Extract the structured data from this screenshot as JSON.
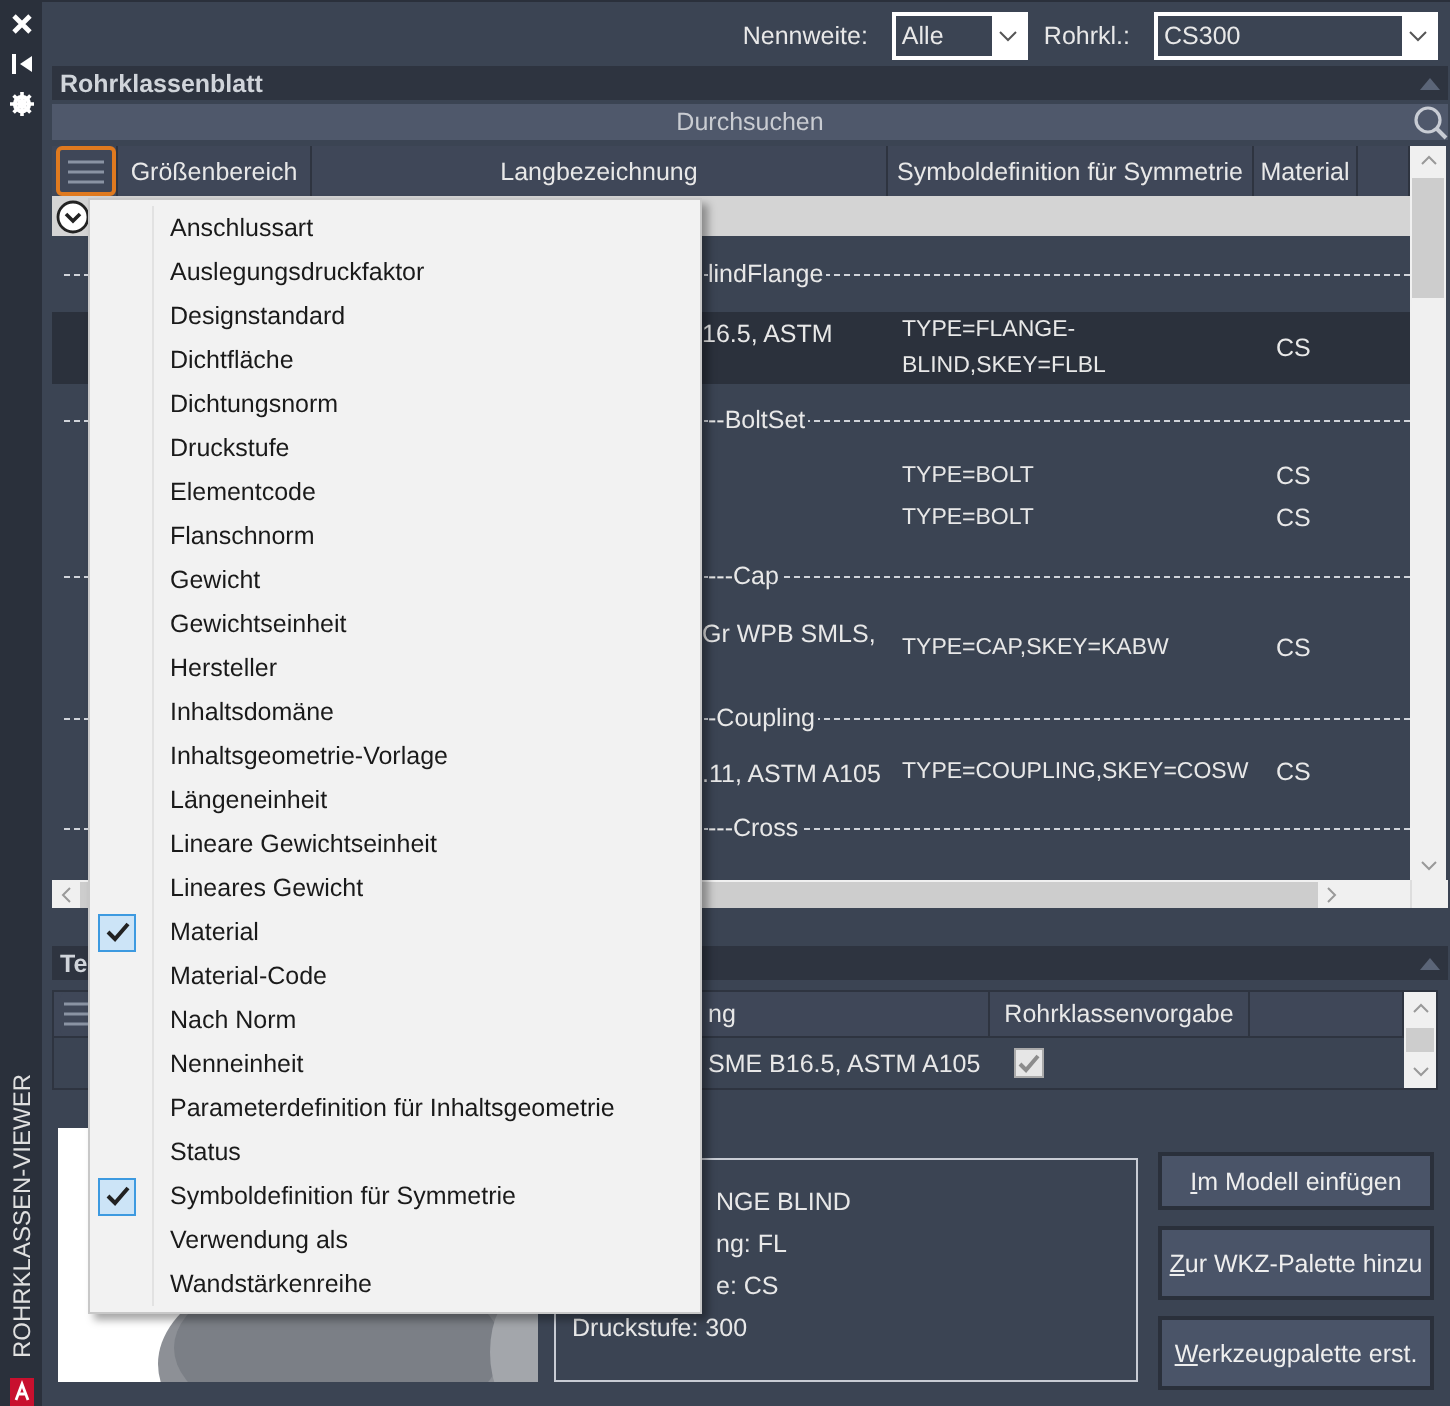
{
  "side_panel": {
    "title": "ROHRKLASSEN-VIEWER"
  },
  "filters": [
    {
      "label": "Nennweite:",
      "value": "Alle",
      "kind": "short"
    },
    {
      "label": "Rohrkl.:",
      "value": "CS300",
      "kind": "wide"
    }
  ],
  "spec_sheet": {
    "title": "Rohrklassenblatt",
    "search": {
      "placeholder": "Durchsuchen"
    },
    "column_menu_open": true,
    "columns": [
      "Größenbereich",
      "Langbezeichnung",
      "Symboldefinition für Symmetrie",
      "Material"
    ],
    "rows": [
      {
        "kind": "group",
        "label": "lindFlange"
      },
      {
        "kind": "part",
        "selected": true,
        "long_name": "16.5, ASTM",
        "symbol": "TYPE=FLANGE-BLIND,SKEY=FLBL",
        "material": "CS"
      },
      {
        "kind": "group",
        "label": "--BoltSet"
      },
      {
        "kind": "part",
        "selected": false,
        "symbol": "TYPE=BOLT",
        "material": "CS"
      },
      {
        "kind": "part",
        "selected": false,
        "symbol": "TYPE=BOLT",
        "material": "CS"
      },
      {
        "kind": "group",
        "label": "---Cap"
      },
      {
        "kind": "part",
        "selected": false,
        "long_name": "Gr WPB SMLS,",
        "symbol": "TYPE=CAP,SKEY=KABW",
        "material": "CS"
      },
      {
        "kind": "group",
        "label": "-Coupling"
      },
      {
        "kind": "part",
        "selected": false,
        "long_name": ".11, ASTM A105",
        "symbol": "TYPE=COUPLING,SKEY=COSW",
        "material": "CS"
      },
      {
        "kind": "group",
        "label": "---Cross"
      }
    ]
  },
  "column_menu": [
    {
      "label": "Anschlussart",
      "checked": false
    },
    {
      "label": "Auslegungsdruckfaktor",
      "checked": false
    },
    {
      "label": "Designstandard",
      "checked": false
    },
    {
      "label": "Dichtfläche",
      "checked": false
    },
    {
      "label": "Dichtungsnorm",
      "checked": false
    },
    {
      "label": "Druckstufe",
      "checked": false
    },
    {
      "label": "Elementcode",
      "checked": false
    },
    {
      "label": "Flanschnorm",
      "checked": false
    },
    {
      "label": "Gewicht",
      "checked": false
    },
    {
      "label": "Gewichtseinheit",
      "checked": false
    },
    {
      "label": "Hersteller",
      "checked": false
    },
    {
      "label": "Inhaltsdomäne",
      "checked": false
    },
    {
      "label": "Inhaltsgeometrie-Vorlage",
      "checked": false
    },
    {
      "label": "Längeneinheit",
      "checked": false
    },
    {
      "label": "Lineare Gewichtseinheit",
      "checked": false
    },
    {
      "label": "Lineares Gewicht",
      "checked": false
    },
    {
      "label": "Material",
      "checked": true
    },
    {
      "label": "Material-Code",
      "checked": false
    },
    {
      "label": "Nach Norm",
      "checked": false
    },
    {
      "label": "Nenneinheit",
      "checked": false
    },
    {
      "label": "Parameterdefinition für Inhaltsgeometrie",
      "checked": false
    },
    {
      "label": "Status",
      "checked": false
    },
    {
      "label": "Symboldefinition für Symmetrie",
      "checked": true
    },
    {
      "label": "Verwendung als",
      "checked": false
    },
    {
      "label": "Wandstärkenreihe",
      "checked": false
    }
  ],
  "parts_table": {
    "title": "Te",
    "columns": [
      "ng",
      "Rohrklassenvorgabe"
    ],
    "rows": [
      {
        "long_name": "SME B16.5, ASTM A105",
        "default": true
      }
    ]
  },
  "preview": {
    "kind": "picture"
  },
  "details": [
    "NGE BLIND",
    "ng: FL",
    "e: CS",
    "Druckstufe: 300"
  ],
  "buttons": [
    "Im Modell einfügen",
    "Zur WKZ-Palette hinzu",
    "Werkzeugpalette erst."
  ]
}
